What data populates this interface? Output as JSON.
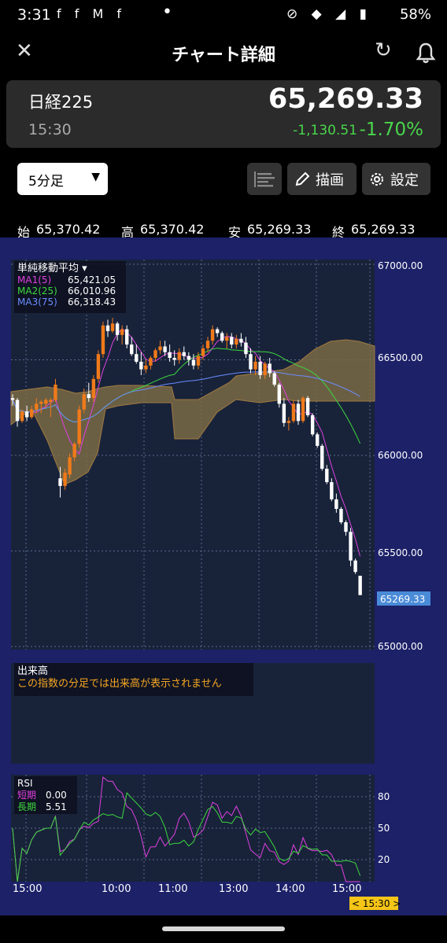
{
  "status_bar": {
    "time": "3:31",
    "battery": "58%",
    "app_icons": "f f M f"
  },
  "header": {
    "title": "チャート詳細"
  },
  "quote": {
    "name": "日経225",
    "time": "15:30",
    "price": "65,269.33",
    "change": "-1,130.51",
    "change_pct": "-1.70%",
    "change_color": "#49d64b"
  },
  "toolbar": {
    "interval": "5分足",
    "draw_label": "描画",
    "settings_label": "設定"
  },
  "ohlc": {
    "open_label": "始",
    "open": "65,370.42",
    "high_label": "高",
    "high": "65,370.42",
    "low_label": "安",
    "low": "65,269.33",
    "close_label": "終",
    "close": "65,269.33"
  },
  "indicator": {
    "title": "単純移動平均",
    "ma1_label": "MA1(5)",
    "ma1_value": "65,421.05",
    "ma1_color": "#e040e0",
    "ma2_label": "MA2(25)",
    "ma2_value": "66,010.96",
    "ma2_color": "#3ed83e",
    "ma3_label": "MA3(75)",
    "ma3_value": "66,318.43",
    "ma3_color": "#6a8cff"
  },
  "price_axis": {
    "ticks": [
      "67000.00",
      "66500.00",
      "66000.00",
      "65500.00",
      "65000.00"
    ],
    "current": "65269.33"
  },
  "volume_panel": {
    "title": "出来高",
    "message": "この指数の分足では出来高が表示されません"
  },
  "rsi_panel": {
    "title": "RSI",
    "short_label": "短期",
    "short_value": "0.00",
    "long_label": "長期",
    "long_value": "5.51",
    "ticks": [
      "80",
      "50",
      "20"
    ]
  },
  "time_axis": {
    "labels": [
      "15:00",
      "10:00",
      "11:00",
      "13:00",
      "14:00",
      "15:00"
    ],
    "cursor": "< 15:30 >"
  },
  "chart_data": {
    "type": "candlestick",
    "interval": "5分足",
    "last_close": 65269.33,
    "ylim": [
      65000,
      67000
    ],
    "candles": [
      {
        "o": 66300,
        "h": 66320,
        "l": 66260,
        "c": 66290
      },
      {
        "o": 66290,
        "h": 66300,
        "l": 66150,
        "c": 66180
      },
      {
        "o": 66180,
        "h": 66240,
        "l": 66170,
        "c": 66230
      },
      {
        "o": 66230,
        "h": 66260,
        "l": 66180,
        "c": 66200
      },
      {
        "o": 66200,
        "h": 66260,
        "l": 66190,
        "c": 66240
      },
      {
        "o": 66240,
        "h": 66300,
        "l": 66220,
        "c": 66270
      },
      {
        "o": 66270,
        "h": 66290,
        "l": 66220,
        "c": 66280
      },
      {
        "o": 66270,
        "h": 66300,
        "l": 66250,
        "c": 66290
      },
      {
        "o": 66280,
        "h": 66300,
        "l": 66200,
        "c": 66290
      },
      {
        "o": 66290,
        "h": 66400,
        "l": 66280,
        "c": 66370
      },
      {
        "o": 65880,
        "h": 65940,
        "l": 65780,
        "c": 65840
      },
      {
        "o": 65840,
        "h": 65930,
        "l": 65820,
        "c": 65910
      },
      {
        "o": 65900,
        "h": 66010,
        "l": 65880,
        "c": 65990
      },
      {
        "o": 65990,
        "h": 66070,
        "l": 65970,
        "c": 66060
      },
      {
        "o": 66060,
        "h": 66260,
        "l": 66040,
        "c": 66240
      },
      {
        "o": 66240,
        "h": 66350,
        "l": 66220,
        "c": 66320
      },
      {
        "o": 66320,
        "h": 66380,
        "l": 66280,
        "c": 66300
      },
      {
        "o": 66300,
        "h": 66420,
        "l": 66280,
        "c": 66400
      },
      {
        "o": 66400,
        "h": 66550,
        "l": 66380,
        "c": 66530
      },
      {
        "o": 66530,
        "h": 66700,
        "l": 66510,
        "c": 66680
      },
      {
        "o": 66680,
        "h": 66710,
        "l": 66620,
        "c": 66650
      },
      {
        "o": 66650,
        "h": 66720,
        "l": 66640,
        "c": 66690
      },
      {
        "o": 66690,
        "h": 66700,
        "l": 66600,
        "c": 66630
      },
      {
        "o": 66630,
        "h": 66680,
        "l": 66580,
        "c": 66660
      },
      {
        "o": 66660,
        "h": 66680,
        "l": 66560,
        "c": 66580
      },
      {
        "o": 66580,
        "h": 66620,
        "l": 66520,
        "c": 66530
      },
      {
        "o": 66530,
        "h": 66580,
        "l": 66480,
        "c": 66490
      },
      {
        "o": 66490,
        "h": 66540,
        "l": 66420,
        "c": 66450
      },
      {
        "o": 66450,
        "h": 66500,
        "l": 66430,
        "c": 66470
      },
      {
        "o": 66470,
        "h": 66520,
        "l": 66450,
        "c": 66510
      },
      {
        "o": 66510,
        "h": 66560,
        "l": 66490,
        "c": 66550
      },
      {
        "o": 66550,
        "h": 66600,
        "l": 66530,
        "c": 66570
      },
      {
        "o": 66570,
        "h": 66600,
        "l": 66520,
        "c": 66540
      },
      {
        "o": 66540,
        "h": 66580,
        "l": 66490,
        "c": 66510
      },
      {
        "o": 66510,
        "h": 66550,
        "l": 66470,
        "c": 66500
      },
      {
        "o": 66500,
        "h": 66560,
        "l": 66480,
        "c": 66540
      },
      {
        "o": 66540,
        "h": 66570,
        "l": 66500,
        "c": 66520
      },
      {
        "o": 66520,
        "h": 66540,
        "l": 66470,
        "c": 66500
      },
      {
        "o": 66500,
        "h": 66530,
        "l": 66450,
        "c": 66470
      },
      {
        "o": 66470,
        "h": 66540,
        "l": 66450,
        "c": 66520
      },
      {
        "o": 66520,
        "h": 66580,
        "l": 66500,
        "c": 66560
      },
      {
        "o": 66560,
        "h": 66620,
        "l": 66540,
        "c": 66600
      },
      {
        "o": 66600,
        "h": 66680,
        "l": 66580,
        "c": 66660
      },
      {
        "o": 66660,
        "h": 66670,
        "l": 66620,
        "c": 66640
      },
      {
        "o": 66640,
        "h": 66650,
        "l": 66590,
        "c": 66600
      },
      {
        "o": 66600,
        "h": 66640,
        "l": 66560,
        "c": 66620
      },
      {
        "o": 66620,
        "h": 66640,
        "l": 66560,
        "c": 66580
      },
      {
        "o": 66580,
        "h": 66630,
        "l": 66560,
        "c": 66610
      },
      {
        "o": 66610,
        "h": 66640,
        "l": 66570,
        "c": 66590
      },
      {
        "o": 66590,
        "h": 66620,
        "l": 66510,
        "c": 66530
      },
      {
        "o": 66530,
        "h": 66560,
        "l": 66430,
        "c": 66450
      },
      {
        "o": 66450,
        "h": 66520,
        "l": 66420,
        "c": 66490
      },
      {
        "o": 66490,
        "h": 66520,
        "l": 66400,
        "c": 66420
      },
      {
        "o": 66420,
        "h": 66490,
        "l": 66400,
        "c": 66480
      },
      {
        "o": 66480,
        "h": 66510,
        "l": 66410,
        "c": 66430
      },
      {
        "o": 66430,
        "h": 66440,
        "l": 66360,
        "c": 66370
      },
      {
        "o": 66370,
        "h": 66380,
        "l": 66250,
        "c": 66270
      },
      {
        "o": 66270,
        "h": 66300,
        "l": 66150,
        "c": 66170
      },
      {
        "o": 66170,
        "h": 66200,
        "l": 66130,
        "c": 66180
      },
      {
        "o": 66180,
        "h": 66290,
        "l": 66170,
        "c": 66270
      },
      {
        "o": 66270,
        "h": 66290,
        "l": 66160,
        "c": 66180
      },
      {
        "o": 66180,
        "h": 66310,
        "l": 66170,
        "c": 66300
      },
      {
        "o": 66300,
        "h": 66310,
        "l": 66200,
        "c": 66210
      },
      {
        "o": 66210,
        "h": 66220,
        "l": 66100,
        "c": 66110
      },
      {
        "o": 66110,
        "h": 66120,
        "l": 66040,
        "c": 66050
      },
      {
        "o": 66050,
        "h": 66060,
        "l": 65920,
        "c": 65930
      },
      {
        "o": 65930,
        "h": 65950,
        "l": 65850,
        "c": 65860
      },
      {
        "o": 65860,
        "h": 65880,
        "l": 65760,
        "c": 65770
      },
      {
        "o": 65770,
        "h": 65800,
        "l": 65700,
        "c": 65720
      },
      {
        "o": 65720,
        "h": 65730,
        "l": 65640,
        "c": 65650
      },
      {
        "o": 65650,
        "h": 65660,
        "l": 65580,
        "c": 65600
      },
      {
        "o": 65600,
        "h": 65620,
        "l": 65420,
        "c": 65450
      },
      {
        "o": 65450,
        "h": 65460,
        "l": 65380,
        "c": 65390
      },
      {
        "o": 65370,
        "h": 65370,
        "l": 65269,
        "c": 65269
      }
    ],
    "ma1_close": 65421.05,
    "ma2_close": 66010.96,
    "ma3_close": 66318.43,
    "rsi": {
      "short": 0.0,
      "long": 5.51,
      "ylim": [
        0,
        100
      ]
    }
  }
}
